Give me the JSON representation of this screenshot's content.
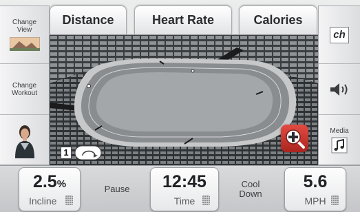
{
  "tabs": {
    "distance": "Distance",
    "heart_rate": "Heart Rate",
    "calories": "Calories"
  },
  "left_panel": {
    "change_view": "Change View",
    "change_workout": "Change Workout"
  },
  "right_panel": {
    "ch_logo": "ch",
    "media": "Media"
  },
  "scene": {
    "lap_count": "1"
  },
  "bottom": {
    "incline_value": "2.5",
    "incline_percent": "%",
    "incline_label": "Incline",
    "pause": "Pause",
    "time_value": "12:45",
    "time_label": "Time",
    "cool_down_line1": "Cool",
    "cool_down_line2": "Down",
    "speed_value": "5.6",
    "speed_label": "MPH"
  },
  "colors": {
    "track": "#8a8d90",
    "infield": "#9ea2a5",
    "zoom_accent": "#c8362f"
  }
}
